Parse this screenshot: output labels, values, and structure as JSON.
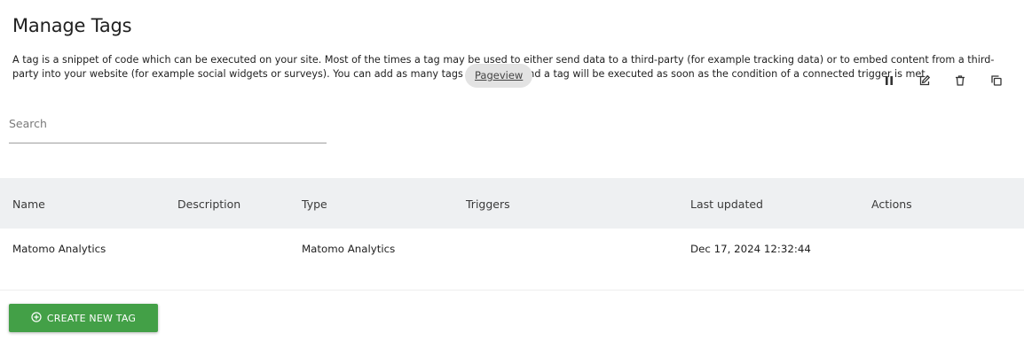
{
  "page": {
    "title": "Manage Tags",
    "intro": "A tag is a snippet of code which can be executed on your site. Most of the times a tag may be used to either send data to a third-party (for example tracking data) or to embed content from a third-party into your website (for example social widgets or surveys). You can add as many tags as you like and a tag will be executed as soon as the condition of a connected trigger is met."
  },
  "search": {
    "placeholder": "Search",
    "value": ""
  },
  "table": {
    "columns": [
      "Name",
      "Description",
      "Type",
      "Triggers",
      "Last updated",
      "Actions"
    ],
    "rows": [
      {
        "name": "Matomo Analytics",
        "description": "",
        "type": "Matomo Analytics",
        "trigger": "Pageview",
        "last_updated": "Dec 17, 2024 12:32:44",
        "actions": [
          "pause-icon",
          "edit-icon",
          "delete-icon",
          "copy-icon"
        ]
      }
    ]
  },
  "buttons": {
    "create_new_tag": "CREATE NEW TAG"
  },
  "colors": {
    "primary_button": "#43a047",
    "table_header_bg": "#eef0f2",
    "trigger_pill_bg": "#e3e3e3"
  }
}
